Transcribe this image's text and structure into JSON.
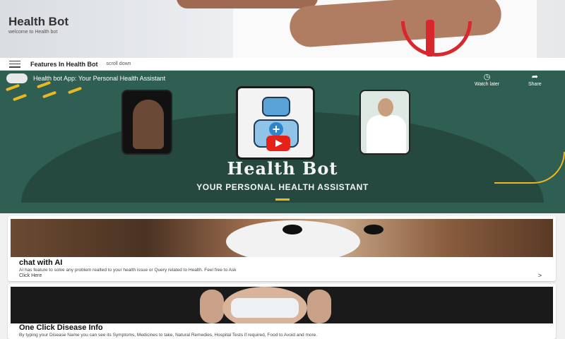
{
  "hero": {
    "title": "Health Bot",
    "subtitle": "welcome to Health bot"
  },
  "toolbar": {
    "menu_icon": "hamburger-icon",
    "title": "Features In Health Bot",
    "hint": "scroll down"
  },
  "video": {
    "title": "Health bot App: Your Personal Health Assistant",
    "watch_later_label": "Watch later",
    "share_label": "Share",
    "brand": "Health Bot",
    "tagline": "YOUR PERSONAL HEALTH ASSISTANT",
    "colors": {
      "background": "#2f5e52",
      "accent": "#e8b923",
      "play": "#e62117"
    }
  },
  "features": [
    {
      "title": "chat with AI",
      "description": "AI has feature to solve any problem realted to your health issue or Query related to Health. Feel free to Ask",
      "link_label": "Click Here",
      "chevron": ">"
    },
    {
      "title": "One Click Disease Info",
      "description": "By typing your Disease Name you can see its Symptoms, Medicines to take, Natural Remedies, Hospital Tests if required, Food to Avoid and more."
    }
  ]
}
